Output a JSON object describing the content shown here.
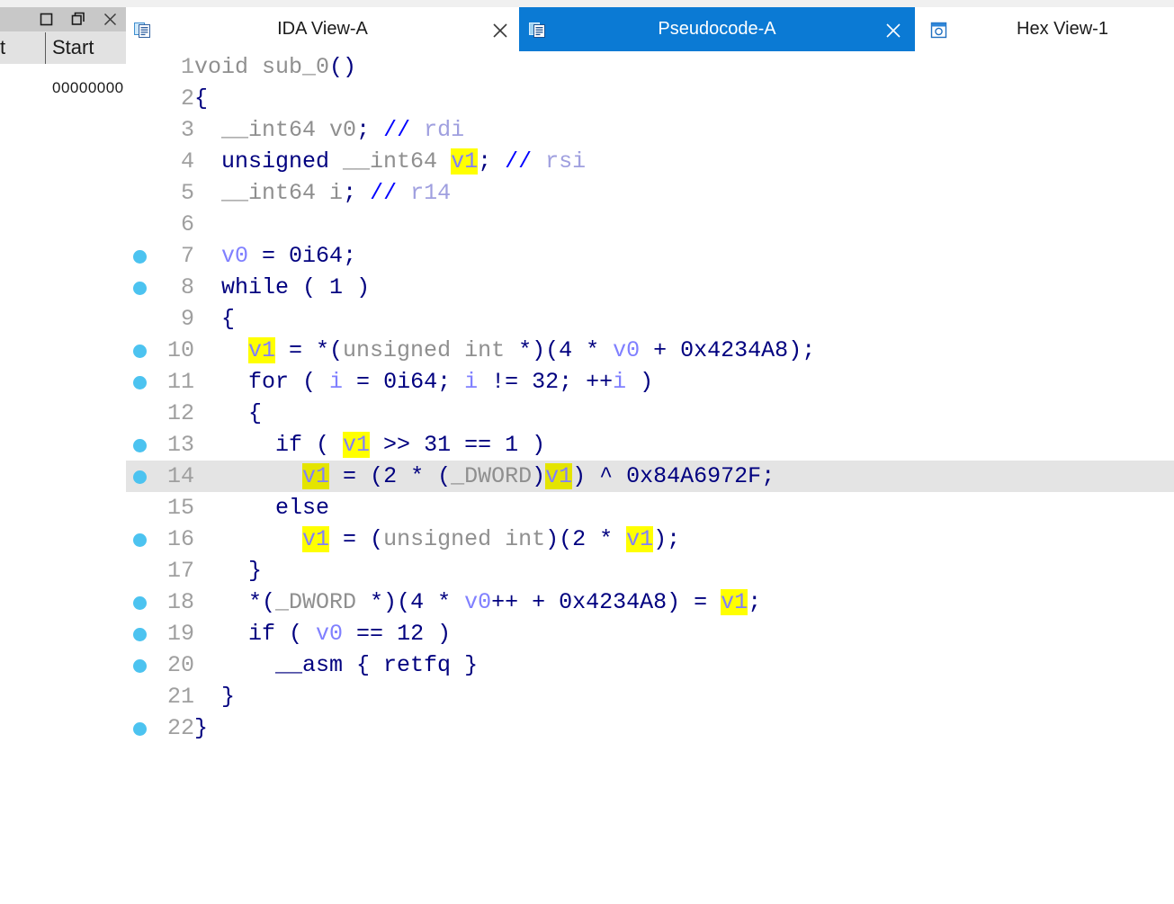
{
  "window": {
    "title_buttons": [
      {
        "name": "maximize-button",
        "glyph": "maximize"
      },
      {
        "name": "restore-button",
        "glyph": "restore"
      },
      {
        "name": "close-button",
        "glyph": "close"
      }
    ],
    "left_panel": {
      "column_partial": "t",
      "column_start": "Start",
      "address_value": "00000000"
    }
  },
  "tabs": [
    {
      "label": "IDA View-A",
      "icon": "document-list-icon",
      "active": false,
      "closable": true
    },
    {
      "label": "Pseudocode-A",
      "icon": "document-list-icon",
      "active": true,
      "closable": true
    },
    {
      "label": "Hex View-1",
      "icon": "hex-view-icon",
      "active": false,
      "closable": false
    }
  ],
  "colors": {
    "active_tab_bg": "#0b7ad4",
    "breakpoint_dot": "#4cc3f0",
    "highlight_row": "#e4e4e4",
    "highlight_token": "#ffff00",
    "keyword": "#00007f",
    "identifier": "#8f8f8f",
    "variable": "#8080ff",
    "comment": "#9f9fdf"
  },
  "code": {
    "function_name": "sub_0",
    "highlighted_token": "v1",
    "current_line": 14,
    "lines": [
      {
        "n": "1",
        "bp": false,
        "indent": 0,
        "tokens": [
          {
            "t": "void ",
            "c": "id"
          },
          {
            "t": "sub_0",
            "c": "id"
          },
          {
            "t": "()",
            "c": "kw"
          }
        ]
      },
      {
        "n": "2",
        "bp": false,
        "indent": 0,
        "tokens": [
          {
            "t": "{",
            "c": "kw"
          }
        ]
      },
      {
        "n": "3",
        "bp": false,
        "indent": 1,
        "tokens": [
          {
            "t": "__int64 ",
            "c": "id"
          },
          {
            "t": "v0",
            "c": "id"
          },
          {
            "t": ";",
            "c": "kw"
          },
          {
            "t": " ",
            "c": "plain"
          },
          {
            "t": "//",
            "c": "cmtsl"
          },
          {
            "t": " ",
            "c": "plain"
          },
          {
            "t": "rdi",
            "c": "cmt"
          }
        ]
      },
      {
        "n": "4",
        "bp": false,
        "indent": 1,
        "tokens": [
          {
            "t": "unsigned ",
            "c": "kw"
          },
          {
            "t": "__int64 ",
            "c": "id"
          },
          {
            "t": "v1",
            "c": "hl"
          },
          {
            "t": ";",
            "c": "kw"
          },
          {
            "t": " ",
            "c": "plain"
          },
          {
            "t": "//",
            "c": "cmtsl"
          },
          {
            "t": " ",
            "c": "plain"
          },
          {
            "t": "rsi",
            "c": "cmt"
          }
        ]
      },
      {
        "n": "5",
        "bp": false,
        "indent": 1,
        "tokens": [
          {
            "t": "__int64 ",
            "c": "id"
          },
          {
            "t": "i",
            "c": "id"
          },
          {
            "t": ";",
            "c": "kw"
          },
          {
            "t": " ",
            "c": "plain"
          },
          {
            "t": "//",
            "c": "cmtsl"
          },
          {
            "t": " ",
            "c": "plain"
          },
          {
            "t": "r14",
            "c": "cmt"
          }
        ]
      },
      {
        "n": "6",
        "bp": false,
        "indent": 0,
        "tokens": []
      },
      {
        "n": "7",
        "bp": true,
        "indent": 1,
        "tokens": [
          {
            "t": "v0",
            "c": "var"
          },
          {
            "t": " = ",
            "c": "kw"
          },
          {
            "t": "0i64",
            "c": "num"
          },
          {
            "t": ";",
            "c": "kw"
          }
        ]
      },
      {
        "n": "8",
        "bp": true,
        "indent": 1,
        "tokens": [
          {
            "t": "while ( ",
            "c": "kw"
          },
          {
            "t": "1",
            "c": "num"
          },
          {
            "t": " )",
            "c": "kw"
          }
        ]
      },
      {
        "n": "9",
        "bp": false,
        "indent": 1,
        "tokens": [
          {
            "t": "{",
            "c": "kw"
          }
        ]
      },
      {
        "n": "10",
        "bp": true,
        "indent": 2,
        "tokens": [
          {
            "t": "v1",
            "c": "hl"
          },
          {
            "t": " = *(",
            "c": "kw"
          },
          {
            "t": "unsigned int",
            "c": "id"
          },
          {
            "t": " *)(",
            "c": "kw"
          },
          {
            "t": "4",
            "c": "num"
          },
          {
            "t": " * ",
            "c": "kw"
          },
          {
            "t": "v0",
            "c": "var"
          },
          {
            "t": " + ",
            "c": "kw"
          },
          {
            "t": "0x4234A8",
            "c": "num"
          },
          {
            "t": ");",
            "c": "kw"
          }
        ]
      },
      {
        "n": "11",
        "bp": true,
        "indent": 2,
        "tokens": [
          {
            "t": "for ( ",
            "c": "kw"
          },
          {
            "t": "i",
            "c": "var"
          },
          {
            "t": " = ",
            "c": "kw"
          },
          {
            "t": "0i64",
            "c": "num"
          },
          {
            "t": "; ",
            "c": "kw"
          },
          {
            "t": "i",
            "c": "var"
          },
          {
            "t": " != ",
            "c": "kw"
          },
          {
            "t": "32",
            "c": "num"
          },
          {
            "t": "; ++",
            "c": "kw"
          },
          {
            "t": "i",
            "c": "var"
          },
          {
            "t": " )",
            "c": "kw"
          }
        ]
      },
      {
        "n": "12",
        "bp": false,
        "indent": 2,
        "tokens": [
          {
            "t": "{",
            "c": "kw"
          }
        ]
      },
      {
        "n": "13",
        "bp": true,
        "indent": 3,
        "tokens": [
          {
            "t": "if ( ",
            "c": "kw"
          },
          {
            "t": "v1",
            "c": "hl"
          },
          {
            "t": " >> ",
            "c": "kw"
          },
          {
            "t": "31",
            "c": "num"
          },
          {
            "t": " == ",
            "c": "kw"
          },
          {
            "t": "1",
            "c": "num"
          },
          {
            "t": " )",
            "c": "kw"
          }
        ]
      },
      {
        "n": "14",
        "bp": true,
        "indent": 4,
        "tokens": [
          {
            "t": "v1",
            "c": "hl"
          },
          {
            "t": " = (",
            "c": "kw"
          },
          {
            "t": "2",
            "c": "num"
          },
          {
            "t": " * (",
            "c": "kw"
          },
          {
            "t": "_DWORD",
            "c": "id"
          },
          {
            "t": ")",
            "c": "kw"
          },
          {
            "t": "v1",
            "c": "hl"
          },
          {
            "t": ") ^ ",
            "c": "kw"
          },
          {
            "t": "0x84A6972F",
            "c": "num"
          },
          {
            "t": ";",
            "c": "kw"
          }
        ]
      },
      {
        "n": "15",
        "bp": false,
        "indent": 3,
        "tokens": [
          {
            "t": "else",
            "c": "kw"
          }
        ]
      },
      {
        "n": "16",
        "bp": true,
        "indent": 4,
        "tokens": [
          {
            "t": "v1",
            "c": "hl"
          },
          {
            "t": " = (",
            "c": "kw"
          },
          {
            "t": "unsigned int",
            "c": "id"
          },
          {
            "t": ")(",
            "c": "kw"
          },
          {
            "t": "2",
            "c": "num"
          },
          {
            "t": " * ",
            "c": "kw"
          },
          {
            "t": "v1",
            "c": "hl"
          },
          {
            "t": ");",
            "c": "kw"
          }
        ]
      },
      {
        "n": "17",
        "bp": false,
        "indent": 2,
        "tokens": [
          {
            "t": "}",
            "c": "kw"
          }
        ]
      },
      {
        "n": "18",
        "bp": true,
        "indent": 2,
        "tokens": [
          {
            "t": "*(",
            "c": "kw"
          },
          {
            "t": "_DWORD",
            "c": "id"
          },
          {
            "t": " *)(",
            "c": "kw"
          },
          {
            "t": "4",
            "c": "num"
          },
          {
            "t": " * ",
            "c": "kw"
          },
          {
            "t": "v0",
            "c": "var"
          },
          {
            "t": "++ + ",
            "c": "kw"
          },
          {
            "t": "0x4234A8",
            "c": "num"
          },
          {
            "t": ") = ",
            "c": "kw"
          },
          {
            "t": "v1",
            "c": "hl"
          },
          {
            "t": ";",
            "c": "kw"
          }
        ]
      },
      {
        "n": "19",
        "bp": true,
        "indent": 2,
        "tokens": [
          {
            "t": "if ( ",
            "c": "kw"
          },
          {
            "t": "v0",
            "c": "var"
          },
          {
            "t": " == ",
            "c": "kw"
          },
          {
            "t": "12",
            "c": "num"
          },
          {
            "t": " )",
            "c": "kw"
          }
        ]
      },
      {
        "n": "20",
        "bp": true,
        "indent": 3,
        "tokens": [
          {
            "t": "__asm { ",
            "c": "kw"
          },
          {
            "t": "retfq",
            "c": "kw"
          },
          {
            "t": " }",
            "c": "kw"
          }
        ]
      },
      {
        "n": "21",
        "bp": false,
        "indent": 1,
        "tokens": [
          {
            "t": "}",
            "c": "kw"
          }
        ]
      },
      {
        "n": "22",
        "bp": true,
        "indent": 0,
        "tokens": [
          {
            "t": "}",
            "c": "kw"
          }
        ]
      }
    ]
  }
}
